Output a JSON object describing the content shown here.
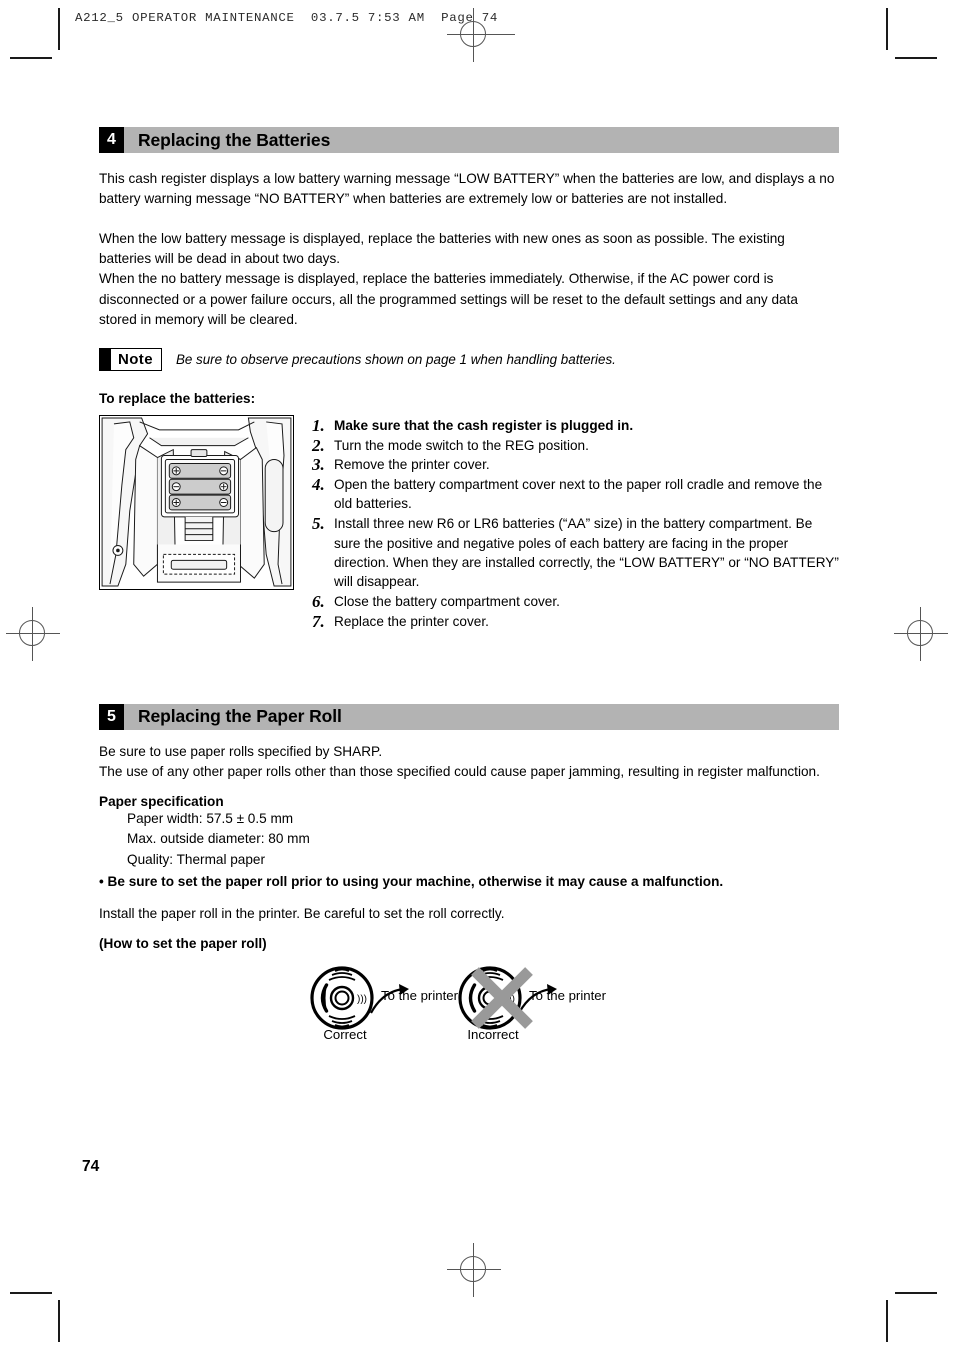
{
  "print_marks": {
    "imposition_header": "A212_5 OPERATOR MAINTENANCE  03.7.5 7:53 AM  Page 74"
  },
  "sections": [
    {
      "number": "4",
      "title": "Replacing the Batteries",
      "paragraphs": [
        "This cash register displays a low battery warning message “LOW BATTERY” when the batteries are low, and displays a no battery warning message “NO BATTERY” when batteries are extremely low or batteries are not installed.",
        "When the low battery message is displayed, replace the batteries with new ones as soon as possible.  The existing batteries will be dead in about two days.\nWhen the no battery message is displayed, replace the batteries immediately.  Otherwise, if the AC power cord is disconnected or a power failure occurs, all the programmed settings will be reset to the default settings and any data stored in memory will be cleared."
      ],
      "note": {
        "label": "Note",
        "text": "Be sure to observe precautions shown on page 1 when handling batteries."
      },
      "subhead": "To replace the batteries:",
      "figure_caption": "battery-compartment-illustration",
      "steps": [
        {
          "num": "1.",
          "text": "Make sure that the cash register is plugged in.",
          "bold": true
        },
        {
          "num": "2.",
          "text": "Turn the mode switch to the REG position.",
          "bold": false
        },
        {
          "num": "3.",
          "text": "Remove the printer cover.",
          "bold": false
        },
        {
          "num": "4.",
          "text": "Open the battery compartment cover next to the paper roll cradle and remove the old batteries.",
          "bold": false
        },
        {
          "num": "5.",
          "text": "Install three new R6 or LR6 batteries (“AA” size) in the battery compartment. Be sure the positive and negative poles of each battery are facing in the proper direction.  When they are installed correctly, the “LOW BATTERY” or “NO BATTERY” will disappear.",
          "bold": false
        },
        {
          "num": "6.",
          "text": "Close the battery compartment cover.",
          "bold": false
        },
        {
          "num": "7.",
          "text": "Replace the printer cover.",
          "bold": false
        }
      ]
    },
    {
      "number": "5",
      "title": "Replacing the Paper Roll",
      "intro": "Be sure to use paper rolls specified by SHARP.\nThe use of any other paper rolls other than those specified could cause paper jamming, resulting in register malfunction.",
      "spec_heading": "Paper specification",
      "spec_items": [
        "Paper width: 57.5 ± 0.5 mm",
        "Max. outside diameter: 80 mm",
        "Quality: Thermal paper"
      ],
      "warning_bullet": "• Be sure to set the paper roll prior to using your machine, otherwise it may cause a malfunction.",
      "install_text": "Install the paper roll in the printer.  Be careful to set the roll correctly.",
      "how_to_heading": "(How to set the paper roll)",
      "rolls": [
        {
          "label": "To the printer",
          "caption": "Correct",
          "crossed": false
        },
        {
          "label": "To the printer",
          "caption": "Incorrect",
          "crossed": true
        }
      ]
    }
  ],
  "footer": {
    "page_number": "74"
  },
  "colors": {
    "banner_gray": "#b3b3b3",
    "number_badge": "#000000",
    "cross_gray": "#999999",
    "battery_fill": "#cccccc"
  }
}
